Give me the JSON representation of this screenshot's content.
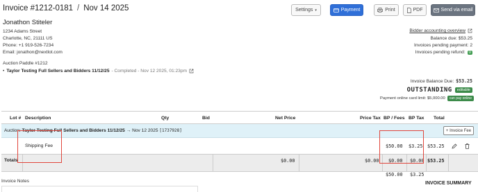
{
  "header": {
    "invoice_number": "Invoice #1212-0181",
    "separator": "/",
    "date": "Nov 14 2025",
    "settings_label": "Settings",
    "payment_label": "Payment",
    "print_label": "Print",
    "pdf_label": "PDF",
    "email_label": "Send via email"
  },
  "customer": {
    "name": "Jonathon Stiteler",
    "street": "1234 Adams Street",
    "city": "Charlotte, NC, 21111 US",
    "phone": "Phone: +1 919-526-7234",
    "email": "Email: jonathon@nextlot.com"
  },
  "auction": {
    "paddle": "Auction Paddle #1212",
    "bullet": "•",
    "name": "Taylor Testing Full Sellers and Bidders 11/12/25",
    "status": "- Completed - Nov 12 2025, 01:23pm"
  },
  "summary": {
    "accounting_link": "Bidder accounting overview",
    "balance_due": "Balance due: $53.25",
    "pending_payment": "Invoices pending payment: 2",
    "pending_refund": "Invoices pending refund:",
    "pending_refund_count": "0",
    "invoice_balance_label": "Invoice Balance Due:",
    "invoice_balance_value": "$53.25",
    "status": "OUTSTANDING",
    "status_badge": "editable",
    "card_limit": "Payment online card limit: $5,000.00",
    "can_pay": "can pay online"
  },
  "table": {
    "headers": {
      "lot": "Lot #",
      "description": "Description",
      "qty": "Qty",
      "bid": "Bid",
      "net_price": "Net Price",
      "price_tax": "Price Tax",
      "bp_fees": "BP / Fees",
      "bp_tax": "BP Tax",
      "total": "Total"
    },
    "group_row": {
      "prefix": "Auction:",
      "name": "Taylor Testing Full Sellers and Bidders 11/12/25",
      "arrow": "→",
      "date": "Nov 12 2025",
      "id": "[1737928]",
      "add_fee_label": "+ Invoice Fee"
    },
    "item": {
      "description": "Shipping Fee",
      "bp_fees": "$50.00",
      "bp_tax": "$3.25",
      "total": "$53.25"
    },
    "totals": {
      "label": "Totals",
      "net_price": "$0.00",
      "price_tax": "$0.00",
      "bp_fees_top": "$0.00",
      "bp_fees_bottom": "$50.00",
      "bp_tax_top": "$0.00",
      "bp_tax_bottom": "$3.25",
      "total": "$53.25"
    }
  },
  "footer": {
    "notes_label": "Invoice Notes",
    "summary_heading": "INVOICE SUMMARY"
  },
  "colors": {
    "primary": "#2f6fd8",
    "group_row_bg": "#dff1f8",
    "success": "#3c8b4a",
    "highlight": "#e0453b"
  }
}
